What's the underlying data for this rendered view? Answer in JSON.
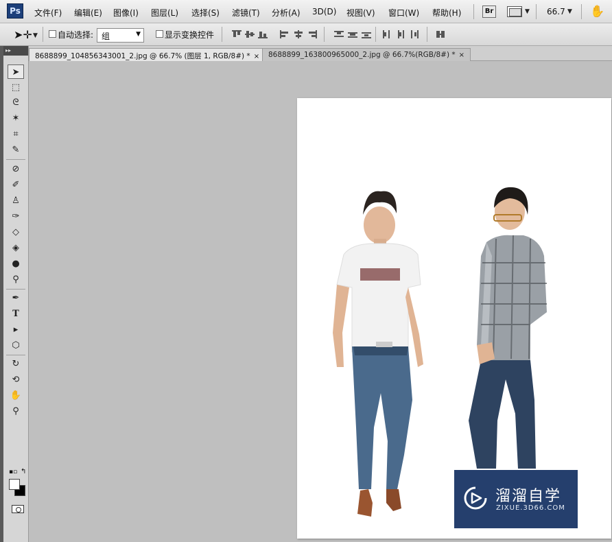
{
  "app": {
    "logo": "Ps"
  },
  "menu": [
    "文件(F)",
    "编辑(E)",
    "图像(I)",
    "图层(L)",
    "选择(S)",
    "滤镜(T)",
    "分析(A)",
    "3D(D)",
    "视图(V)",
    "窗口(W)",
    "帮助(H)"
  ],
  "topbar": {
    "bridge_label": "Br",
    "zoom": "66.7"
  },
  "options": {
    "auto_select_label": "自动选择:",
    "auto_select_value": "组",
    "show_transform_label": "显示变换控件"
  },
  "tabs": [
    {
      "label": "8688899_104856343001_2.jpg @ 66.7% (图层 1, RGB/8#) *",
      "close": "×"
    },
    {
      "label": "8688899_163800965000_2.jpg @ 66.7%(RGB/8#) *",
      "close": "×"
    }
  ],
  "watermark": {
    "title": "溜溜自学",
    "subtitle": "ZIXUE.3D66.COM"
  },
  "colors": {
    "foreground": "#ffffff",
    "background": "#000000",
    "watermark_bg": "#253f6d"
  }
}
